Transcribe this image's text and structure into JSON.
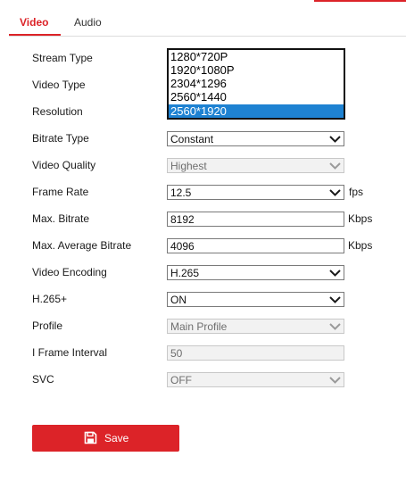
{
  "tabs": [
    {
      "label": "Video",
      "active": true
    },
    {
      "label": "Audio",
      "active": false
    }
  ],
  "colors": {
    "accent": "#dc2328",
    "selection": "#1e82d2"
  },
  "fields": {
    "stream_type": {
      "label": "Stream Type"
    },
    "video_type": {
      "label": "Video Type"
    },
    "resolution": {
      "label": "Resolution",
      "options": [
        "1280*720P",
        "1920*1080P",
        "2304*1296",
        "2560*1440",
        "2560*1920"
      ],
      "selected": "2560*1920"
    },
    "bitrate_type": {
      "label": "Bitrate Type",
      "value": "Constant"
    },
    "video_quality": {
      "label": "Video Quality",
      "value": "Highest",
      "disabled": true
    },
    "frame_rate": {
      "label": "Frame Rate",
      "value": "12.5",
      "unit": "fps"
    },
    "max_bitrate": {
      "label": "Max. Bitrate",
      "value": "8192",
      "unit": "Kbps"
    },
    "max_avg_bitrate": {
      "label": "Max. Average Bitrate",
      "value": "4096",
      "unit": "Kbps"
    },
    "video_encoding": {
      "label": "Video Encoding",
      "value": "H.265"
    },
    "h265_plus": {
      "label": "H.265+",
      "value": "ON"
    },
    "profile": {
      "label": "Profile",
      "value": "Main Profile",
      "disabled": true
    },
    "i_frame_interval": {
      "label": "I Frame Interval",
      "value": "50",
      "disabled": true
    },
    "svc": {
      "label": "SVC",
      "value": "OFF",
      "disabled": true
    }
  },
  "save": {
    "label": "Save",
    "icon": "save-icon"
  }
}
